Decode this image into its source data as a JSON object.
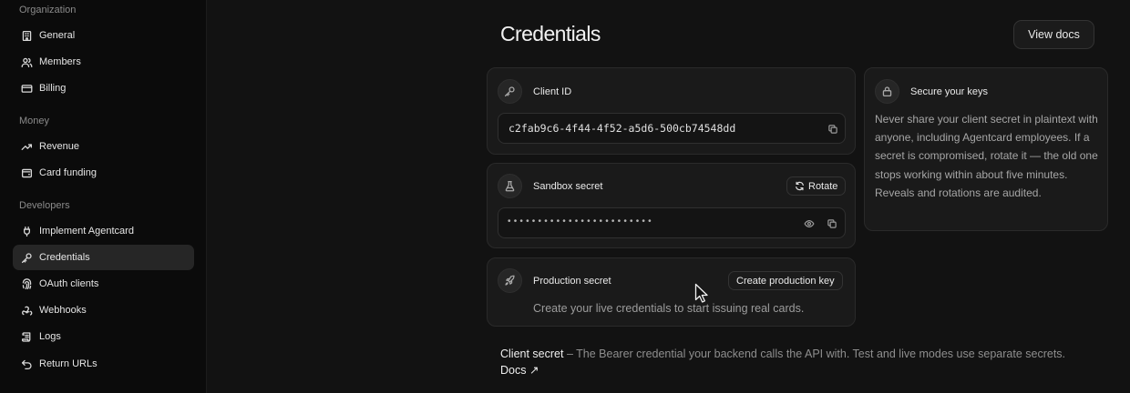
{
  "sidebar": {
    "sections": [
      {
        "title": "Organization",
        "items": [
          {
            "label": "General",
            "icon": "building-icon"
          },
          {
            "label": "Members",
            "icon": "users-icon"
          },
          {
            "label": "Billing",
            "icon": "credit-card-icon"
          }
        ]
      },
      {
        "title": "Money",
        "items": [
          {
            "label": "Revenue",
            "icon": "trending-up-icon"
          },
          {
            "label": "Card funding",
            "icon": "wallet-icon"
          }
        ]
      },
      {
        "title": "Developers",
        "items": [
          {
            "label": "Implement Agentcard",
            "icon": "plug-icon"
          },
          {
            "label": "Credentials",
            "icon": "key-icon",
            "active": true
          },
          {
            "label": "OAuth clients",
            "icon": "fingerprint-icon"
          },
          {
            "label": "Webhooks",
            "icon": "webhook-icon"
          },
          {
            "label": "Logs",
            "icon": "scroll-icon"
          },
          {
            "label": "Return URLs",
            "icon": "undo-arrow-icon"
          }
        ]
      }
    ]
  },
  "header": {
    "title": "Credentials",
    "view_docs_label": "View docs"
  },
  "client_id_card": {
    "label": "Client ID",
    "value": "c2fab9c6-4f44-4f52-a5d6-500cb74548dd"
  },
  "sandbox_card": {
    "label": "Sandbox secret",
    "rotate_label": "Rotate",
    "masked_value": "••••••••••••••••••••••••"
  },
  "production_card": {
    "label": "Production secret",
    "create_label": "Create production key",
    "description": "Create your live credentials to start issuing real cards."
  },
  "info_card": {
    "title": "Secure your keys",
    "text": "Never share your client secret in plaintext with anyone, including Agentcard employees. If a secret is compromised, rotate it — the old one stops working within about five minutes. Reveals and rotations are audited."
  },
  "footnote": {
    "term": "Client secret",
    "text": " – The Bearer credential your backend calls the API with. Test and live modes use separate secrets. ",
    "link_label": "Docs ↗"
  },
  "colors": {
    "background": "#121212",
    "sidebar": "#0b0b0b",
    "card": "#1a1a1a",
    "active_item": "#262626"
  }
}
